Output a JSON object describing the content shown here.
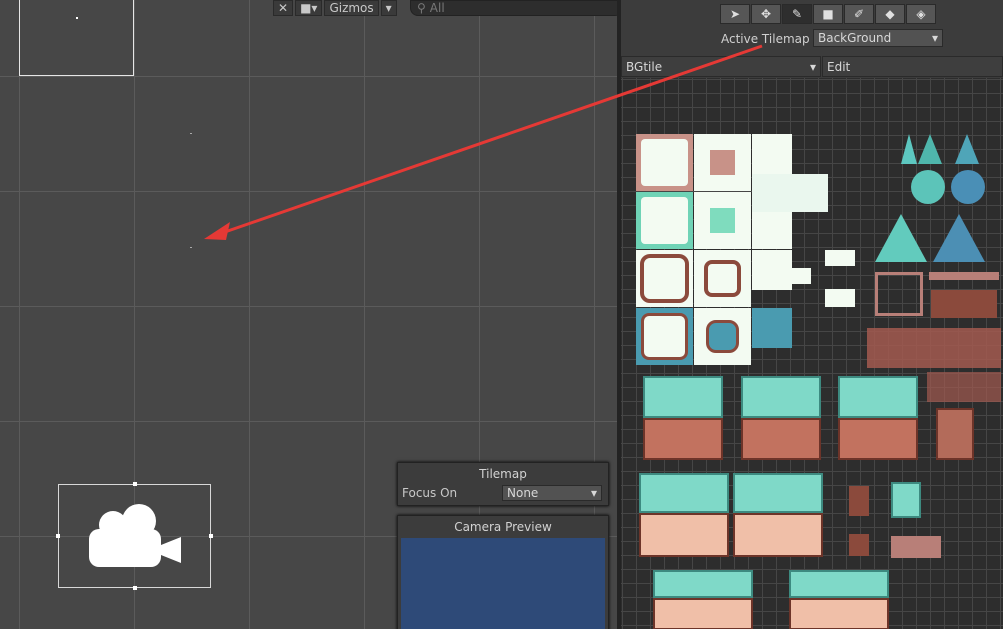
{
  "scene": {
    "toolbar": {
      "tools_icon": "wrench-cross-icon",
      "camera_icon": "video-camera-icon",
      "gizmos_label": "Gizmos",
      "search_placeholder": "All"
    }
  },
  "tilemap_overlay": {
    "title": "Tilemap",
    "focus_label": "Focus On",
    "focus_value": "None"
  },
  "camera_preview": {
    "title": "Camera Preview",
    "preview_color": "#2e4a78"
  },
  "palette": {
    "tools": [
      "select-arrow-icon",
      "move-cross-icon",
      "paint-brush-icon",
      "box-fill-icon",
      "picker-icon",
      "eraser-icon",
      "fill-bucket-icon"
    ],
    "active_tilemap_label": "Active Tilemap",
    "active_tilemap_value": "BackGround",
    "palette_name": "BGtile",
    "edit_label": "Edit"
  },
  "annotation": {
    "color": "#e53935"
  }
}
